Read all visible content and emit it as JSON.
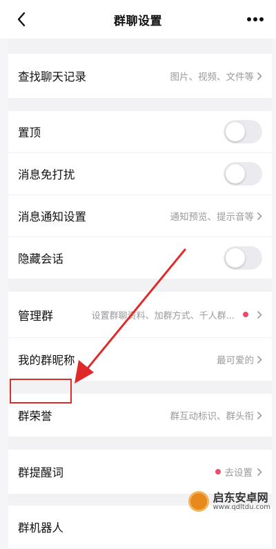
{
  "header": {
    "title": "群聊设置",
    "back_icon": "chevron-left-icon",
    "more_icon": "more-dots-icon"
  },
  "rows": {
    "search_history": {
      "label": "查找聊天记录",
      "value": "图片、视频、文件等"
    },
    "pin_top": {
      "label": "置顶",
      "toggle_on": false
    },
    "do_not_disturb": {
      "label": "消息免打扰",
      "toggle_on": false
    },
    "notification_settings": {
      "label": "消息通知设置",
      "value": "通知预览、提示音等"
    },
    "hide_conversation": {
      "label": "隐藏会话",
      "toggle_on": false
    },
    "manage_group": {
      "label": "管理群",
      "value": "设置群聊资料、加群方式、千人群..."
    },
    "my_nickname": {
      "label": "我的群昵称",
      "value": "最可爱的"
    },
    "group_honor": {
      "label": "群荣誉",
      "value": "群互动标识、群头衔"
    },
    "group_reminder": {
      "label": "群提醒词",
      "value": "去设置"
    },
    "group_robot": {
      "label": "群机器人"
    }
  },
  "colors": {
    "toggle_off": "#ebebef",
    "badge_dot": "#e94e6a",
    "annotation_red": "#e02a2a",
    "secondary_text": "#9a9a9f"
  },
  "watermark": {
    "name": "启东安卓网",
    "url": "www.qdltdu.com"
  }
}
